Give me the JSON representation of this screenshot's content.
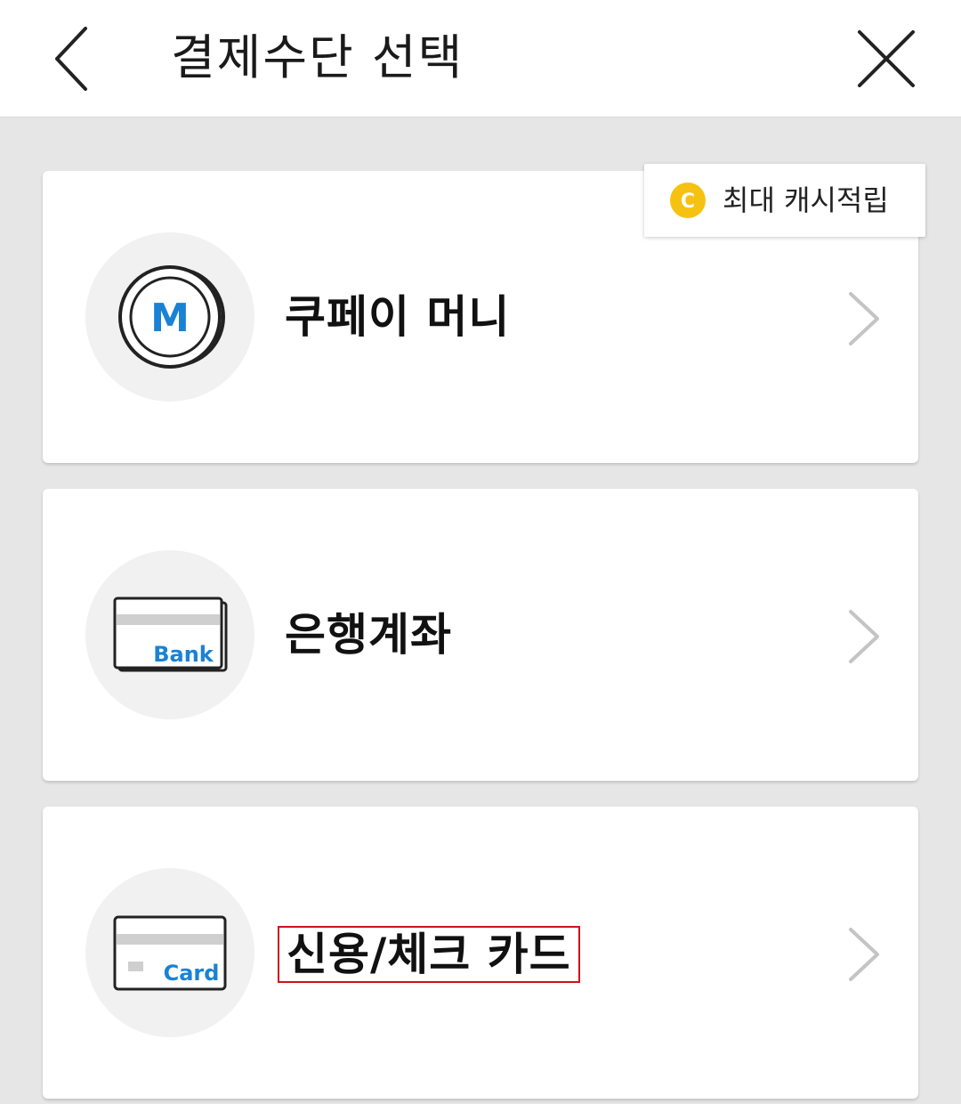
{
  "header": {
    "title": "결제수단 선택"
  },
  "badge": {
    "coin_letter": "C",
    "label": "최대 캐시적립"
  },
  "methods": [
    {
      "label": "쿠페이 머니",
      "icon_text": "M",
      "icon": "coin-m-icon"
    },
    {
      "label": "은행계좌",
      "icon_text": "Bank",
      "icon": "bank-card-icon"
    },
    {
      "label": "신용/체크 카드",
      "icon_text": "Card",
      "icon": "credit-card-icon"
    }
  ],
  "colors": {
    "accent_blue": "#1a82d4",
    "coin_yellow": "#f5c211",
    "highlight_red": "#d0121b",
    "background": "#e6e6e6"
  }
}
